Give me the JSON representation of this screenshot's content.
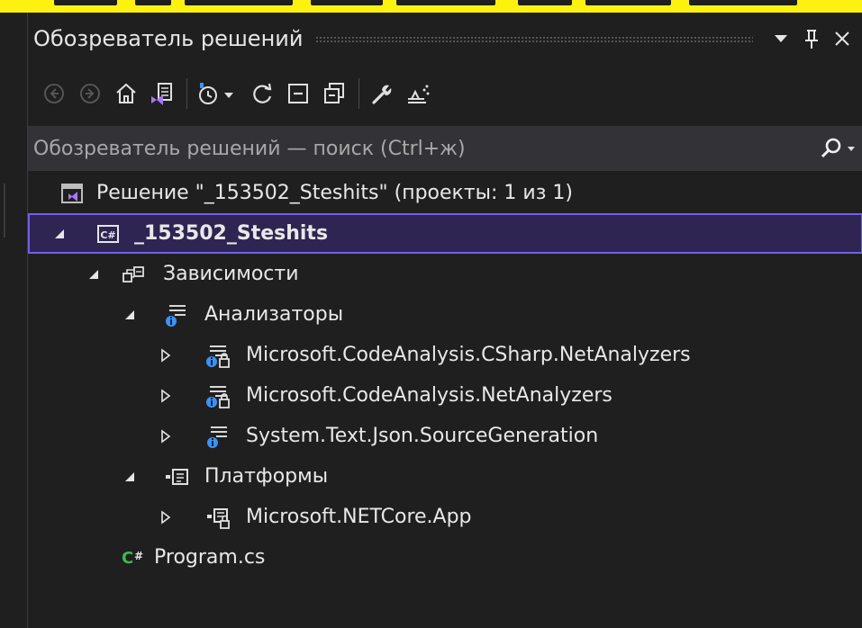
{
  "panel": {
    "title": "Обозреватель решений",
    "title_actions": {
      "dropdown_icon": "chevron-down-icon",
      "pin_icon": "pin-icon",
      "close_icon": "close-icon"
    }
  },
  "toolbar": {
    "buttons": [
      {
        "name": "back-button",
        "icon": "arrow-left-circle-icon",
        "enabled": false
      },
      {
        "name": "forward-button",
        "icon": "arrow-right-circle-icon",
        "enabled": false
      },
      {
        "name": "home-button",
        "icon": "home-icon",
        "enabled": true
      },
      {
        "name": "switch-views-button",
        "icon": "vs-solution-icon",
        "enabled": true
      },
      {
        "name": "pending-changes-filter-button",
        "icon": "clock-icon",
        "enabled": true
      },
      {
        "name": "sync-button",
        "icon": "refresh-icon",
        "enabled": true
      },
      {
        "name": "collapse-all-button",
        "icon": "collapse-icon",
        "enabled": true
      },
      {
        "name": "show-all-files-button",
        "icon": "copy-icon",
        "enabled": true
      },
      {
        "name": "properties-button",
        "icon": "wrench-icon",
        "enabled": true
      },
      {
        "name": "preview-button",
        "icon": "preview-icon",
        "enabled": true
      }
    ]
  },
  "search": {
    "placeholder": "Обозреватель решений — поиск (Ctrl+ж)",
    "icon": "search-icon"
  },
  "tree": {
    "items": [
      {
        "label": "Решение \"_153502_Steshits\" (проекты: 1 из 1)",
        "icon": "solution-icon",
        "expander": "none",
        "bold": false,
        "selected": false
      },
      {
        "label": "_153502_Steshits",
        "icon": "csharp-project-icon",
        "expander": "expanded",
        "bold": true,
        "selected": true
      },
      {
        "label": "Зависимости",
        "icon": "dependencies-icon",
        "expander": "expanded",
        "bold": false,
        "selected": false
      },
      {
        "label": "Анализаторы",
        "icon": "analyzer-icon",
        "expander": "expanded",
        "bold": false,
        "selected": false
      },
      {
        "label": "Microsoft.CodeAnalysis.CSharp.NetAnalyzers",
        "icon": "analyzer-locked-icon",
        "expander": "collapsed",
        "bold": false,
        "selected": false
      },
      {
        "label": "Microsoft.CodeAnalysis.NetAnalyzers",
        "icon": "analyzer-locked-icon",
        "expander": "collapsed",
        "bold": false,
        "selected": false
      },
      {
        "label": "System.Text.Json.SourceGeneration",
        "icon": "analyzer-icon",
        "expander": "collapsed",
        "bold": false,
        "selected": false
      },
      {
        "label": "Платформы",
        "icon": "framework-icon",
        "expander": "expanded",
        "bold": false,
        "selected": false
      },
      {
        "label": "Microsoft.NETCore.App",
        "icon": "framework-locked-icon",
        "expander": "collapsed",
        "bold": false,
        "selected": false
      },
      {
        "label": "Program.cs",
        "icon": "csharp-file-icon",
        "expander": "none",
        "bold": false,
        "selected": false
      }
    ]
  },
  "colors": {
    "background": "#1f1f1f",
    "search_background": "#333337",
    "selection_background": "#2e2552",
    "selection_border": "#7160e8",
    "accent_blue": "#3794ff",
    "csharp_green": "#3fb950"
  }
}
